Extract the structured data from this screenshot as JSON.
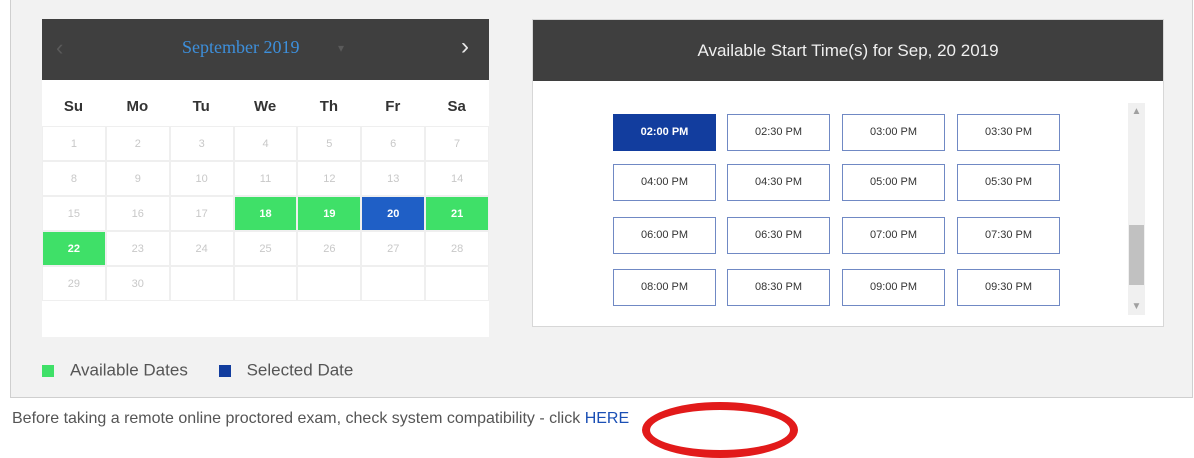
{
  "calendar": {
    "prev_icon": "‹",
    "next_icon": "›",
    "month_title": "September 2019",
    "title_caret": "▾",
    "weekdays": [
      "Su",
      "Mo",
      "Tu",
      "We",
      "Th",
      "Fr",
      "Sa"
    ],
    "weeks": [
      [
        "1",
        "2",
        "3",
        "4",
        "5",
        "6",
        "7"
      ],
      [
        "8",
        "9",
        "10",
        "11",
        "12",
        "13",
        "14"
      ],
      [
        "15",
        "16",
        "17",
        "18",
        "19",
        "20",
        "21"
      ],
      [
        "22",
        "23",
        "24",
        "25",
        "26",
        "27",
        "28"
      ],
      [
        "29",
        "30",
        "",
        "",
        "",
        "",
        ""
      ]
    ],
    "available_dates": [
      "18",
      "19",
      "21",
      "22"
    ],
    "selected_date": "20",
    "colors": {
      "available": "#3fe068",
      "selected": "#1f5fc6"
    }
  },
  "legend": {
    "available_label": "Available Dates",
    "selected_label": "Selected Date"
  },
  "times": {
    "title": "Available Start Time(s) for Sep, 20 2019",
    "selected": "02:00 PM",
    "slots": [
      [
        "02:00 PM",
        "02:30 PM",
        "03:00 PM",
        "03:30 PM"
      ],
      [
        "04:00 PM",
        "04:30 PM",
        "05:00 PM",
        "05:30 PM"
      ],
      [
        "06:00 PM",
        "06:30 PM",
        "07:00 PM",
        "07:30 PM"
      ],
      [
        "08:00 PM",
        "08:30 PM",
        "09:00 PM",
        "09:30 PM"
      ]
    ]
  },
  "note": {
    "text": "Before taking a remote online proctored exam, check system compatibility - click ",
    "link": "HERE"
  }
}
